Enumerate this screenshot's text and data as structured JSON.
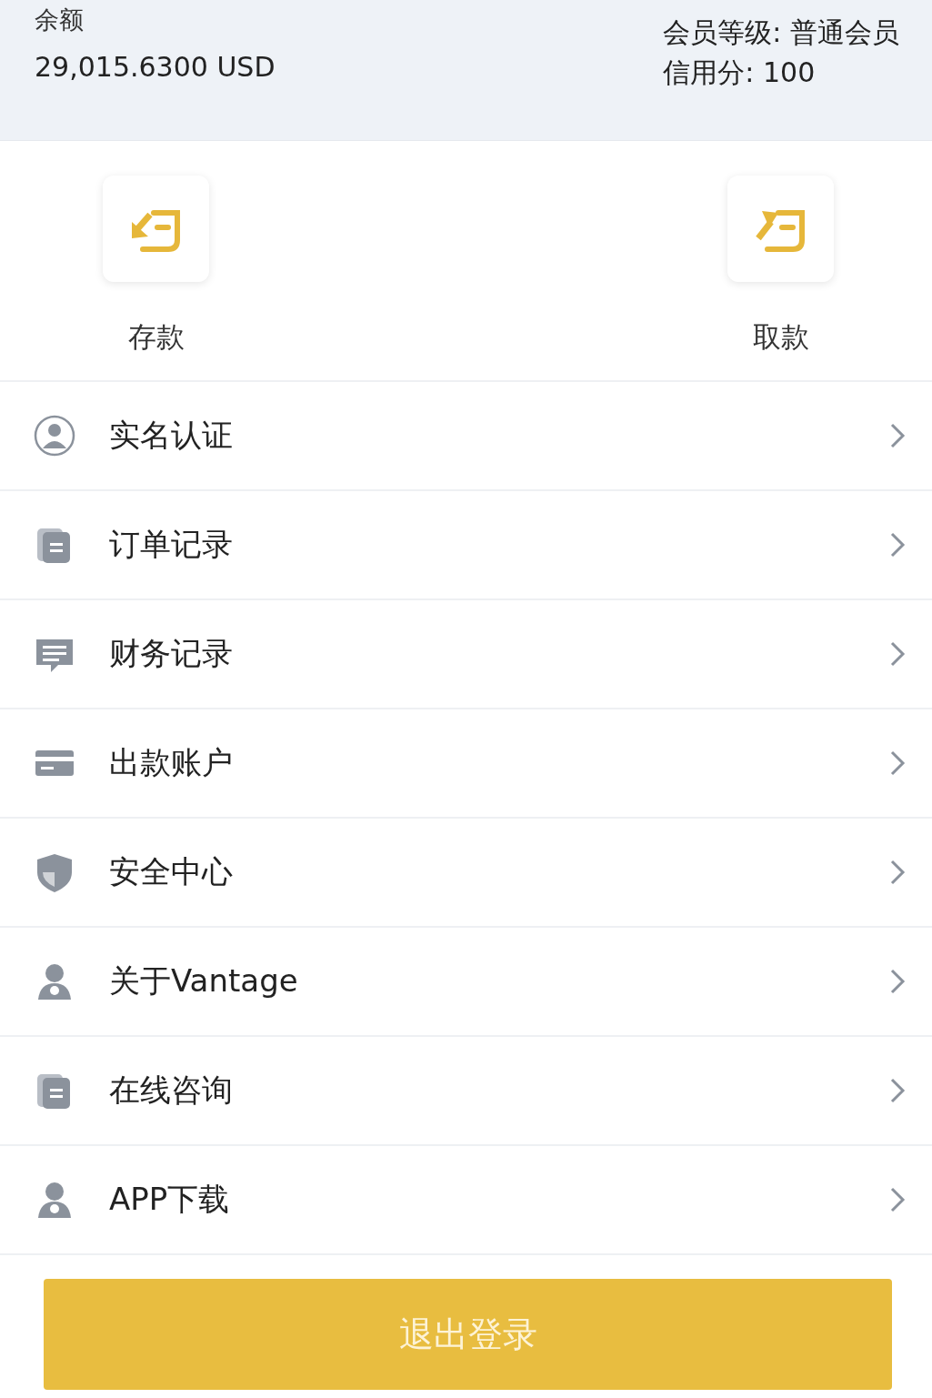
{
  "account": {
    "balance_label": "余额",
    "balance": "29,015.6300 USD",
    "member_level": "会员等级:  普通会员",
    "credit": "信用分:  100"
  },
  "actions": [
    {
      "label": "存款",
      "kind": "deposit"
    },
    {
      "label": "取款",
      "kind": "withdraw"
    }
  ],
  "menu": [
    {
      "label": "实名认证"
    },
    {
      "label": "订单记录"
    },
    {
      "label": "财务记录"
    },
    {
      "label": "出款账户"
    },
    {
      "label": "安全中心"
    },
    {
      "label": "关于Vantage"
    },
    {
      "label": "在线咨询"
    },
    {
      "label": "APP下载"
    }
  ],
  "logout_button": "退出登录"
}
